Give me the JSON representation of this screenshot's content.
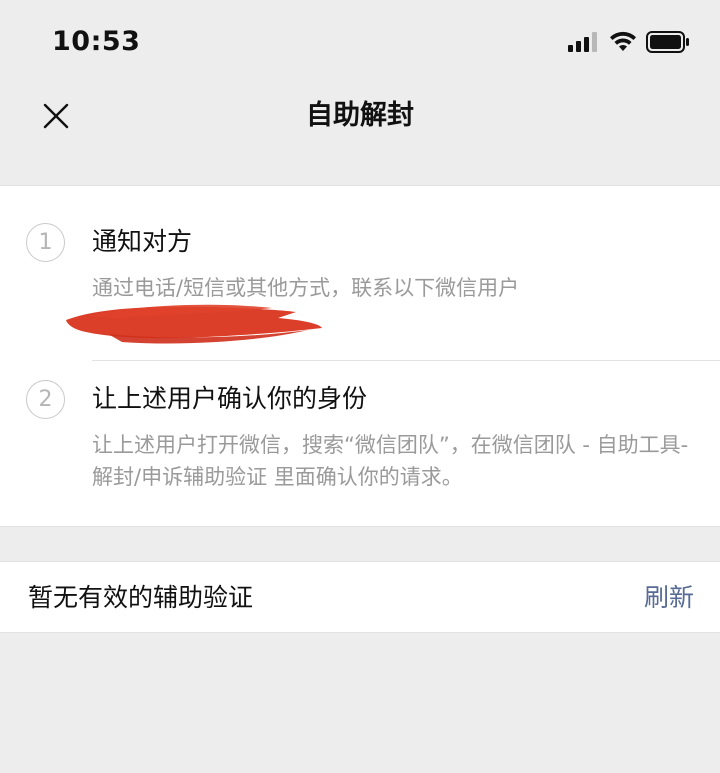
{
  "status_bar": {
    "time": "10:53",
    "icons": [
      "signal-icon",
      "wifi-icon",
      "battery-icon"
    ]
  },
  "nav": {
    "close_icon": "close-icon",
    "title": "自助解封"
  },
  "steps": [
    {
      "number": "1",
      "title": "通知对方",
      "description": "通过电话/短信或其他方式，联系以下微信用户"
    },
    {
      "number": "2",
      "title": "让上述用户确认你的身份",
      "description": "让上述用户打开微信，搜索“微信团队”，在微信团队 - 自助工具-解封/申诉辅助验证 里面确认你的请求。"
    }
  ],
  "assist": {
    "status_text": "暂无有效的辅助验证",
    "refresh_label": "刷新"
  },
  "colors": {
    "background": "#ededed",
    "card": "#ffffff",
    "link": "#576b95",
    "secondary_text": "#9a9a9a",
    "redaction": "#d9341e"
  }
}
